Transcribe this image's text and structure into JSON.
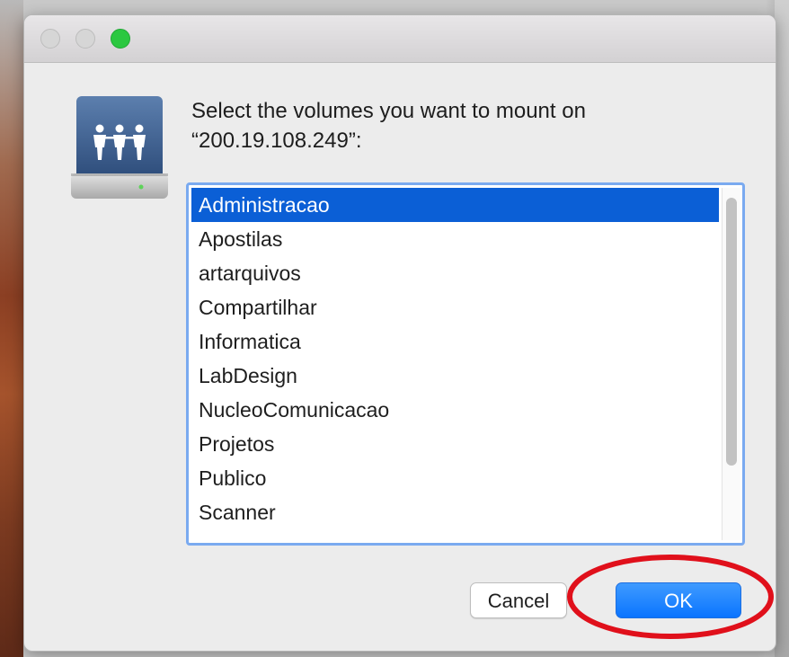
{
  "dialog": {
    "prompt_line1": "Select the volumes you want to mount on",
    "prompt_line2": "“200.19.108.249”:",
    "icon": "network-share-drive-icon"
  },
  "volumes": {
    "selected_index": 0,
    "items": [
      "Administracao",
      "Apostilas",
      "artarquivos",
      "Compartilhar",
      "Informatica",
      "LabDesign",
      "NucleoComunicacao",
      "Projetos",
      "Publico",
      "Scanner"
    ]
  },
  "buttons": {
    "cancel_label": "Cancel",
    "ok_label": "OK"
  },
  "colors": {
    "selection": "#0b5fd6",
    "default_button": "#0a74ff",
    "focus_ring": "#7aaaf0",
    "annotation": "#e0101b",
    "zoom_button": "#2bc840"
  },
  "annotation": {
    "shape": "ellipse",
    "target": "ok-button"
  }
}
